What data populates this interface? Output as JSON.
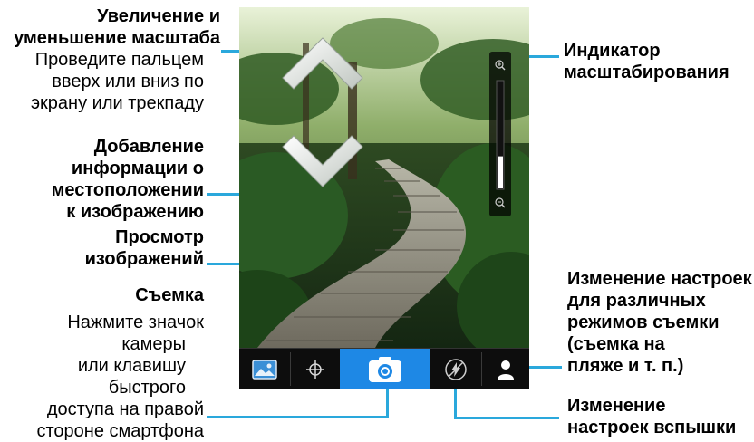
{
  "callouts": {
    "zoom": {
      "title": "Увеличение и уменьшение масштаба",
      "title_lines": [
        "Увеличение и",
        "уменьшение масштаба"
      ],
      "desc_lines": [
        "Проведите пальцем",
        "вверх или вниз по",
        "экрану или трекпаду"
      ]
    },
    "geotag": {
      "title_lines": [
        "Добавление",
        "информации о",
        "местоположении",
        "к изображению"
      ]
    },
    "view": {
      "title_lines": [
        "Просмотр",
        "изображений"
      ]
    },
    "shoot": {
      "title": "Съемка",
      "desc_lines": [
        "Нажмите значок",
        "камеры",
        "или клавишу",
        "быстрого",
        "доступа на правой",
        "стороне смартфона"
      ]
    },
    "zoom_indicator": {
      "title_lines": [
        "Индикатор",
        "масштабирования"
      ]
    },
    "scene_mode": {
      "title_lines": [
        "Изменение настроек",
        "для различных",
        "режимов съемки",
        "(съемка на",
        "пляже и т. п.)"
      ]
    },
    "flash": {
      "title_lines": [
        "Изменение",
        "настроек вспышки"
      ]
    }
  },
  "colors": {
    "callout_line": "#2aa8dc",
    "shutter_active": "#1e88e5",
    "toolbar_bg": "#0d0d0d"
  },
  "icons": {
    "zoom_up": "chevron-up-icon",
    "zoom_down": "chevron-down-icon",
    "gallery": "gallery-icon",
    "geotag": "crosshair-icon",
    "shutter": "camera-icon",
    "flash": "flash-off-icon",
    "scene": "person-icon",
    "zoom_in": "zoom-in-icon",
    "zoom_out": "zoom-out-icon"
  },
  "zoom_level": 0.3
}
